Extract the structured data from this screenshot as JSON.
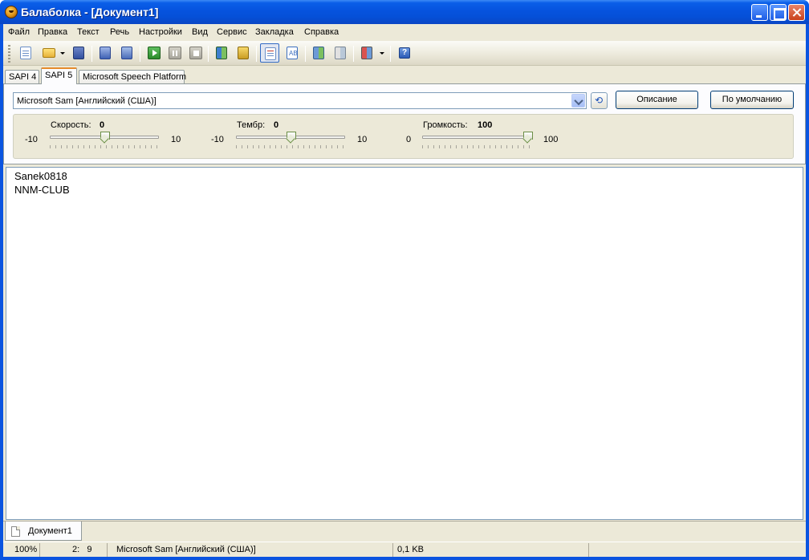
{
  "window": {
    "title": "Балаболка - [Документ1]"
  },
  "menu": [
    "Файл",
    "Правка",
    "Текст",
    "Речь",
    "Настройки",
    "Вид",
    "Сервис",
    "Закладка",
    "Справка"
  ],
  "toolbar": {
    "buttons": [
      "new-document-icon",
      "open-folder-icon",
      "open-dropdown-icon",
      "save-audio-icon",
      "convert-icon",
      "batch-convert-icon",
      "play-icon",
      "pause-icon",
      "stop-icon",
      "read-clipboard-icon",
      "read-file-icon",
      "editor-mode-icon",
      "spell-icon",
      "split-icon",
      "join-icon",
      "book-icon",
      "help-icon"
    ]
  },
  "sapi_tabs": [
    "SAPI 4",
    "SAPI 5",
    "Microsoft Speech Platform"
  ],
  "selected_tab": "SAPI 5",
  "voice": {
    "selected": "Microsoft Sam [Английский (США)]",
    "description_button": "Описание",
    "default_button": "По умолчанию"
  },
  "params": {
    "rate": {
      "label": "Скорость:",
      "value": "0",
      "min": "-10",
      "max": "10",
      "level": 0.5
    },
    "pitch": {
      "label": "Тембр:",
      "value": "0",
      "min": "-10",
      "max": "10",
      "level": 0.5
    },
    "volume": {
      "label": "Громкость:",
      "value": "100",
      "min": "0",
      "max": "100",
      "level": 1.0
    }
  },
  "editor": {
    "lines": [
      "Sanek0818",
      "NNM-CLUB"
    ]
  },
  "doc_tab": "Документ1",
  "status": {
    "zoom": "100%",
    "line": "2:",
    "col": "9",
    "voice": "Microsoft Sam [Английский (США)]",
    "size": "0,1 KB"
  },
  "colors": {
    "title_bar": "#0653de",
    "face": "#ece9d8",
    "accent_tab": "#e68b2c"
  }
}
